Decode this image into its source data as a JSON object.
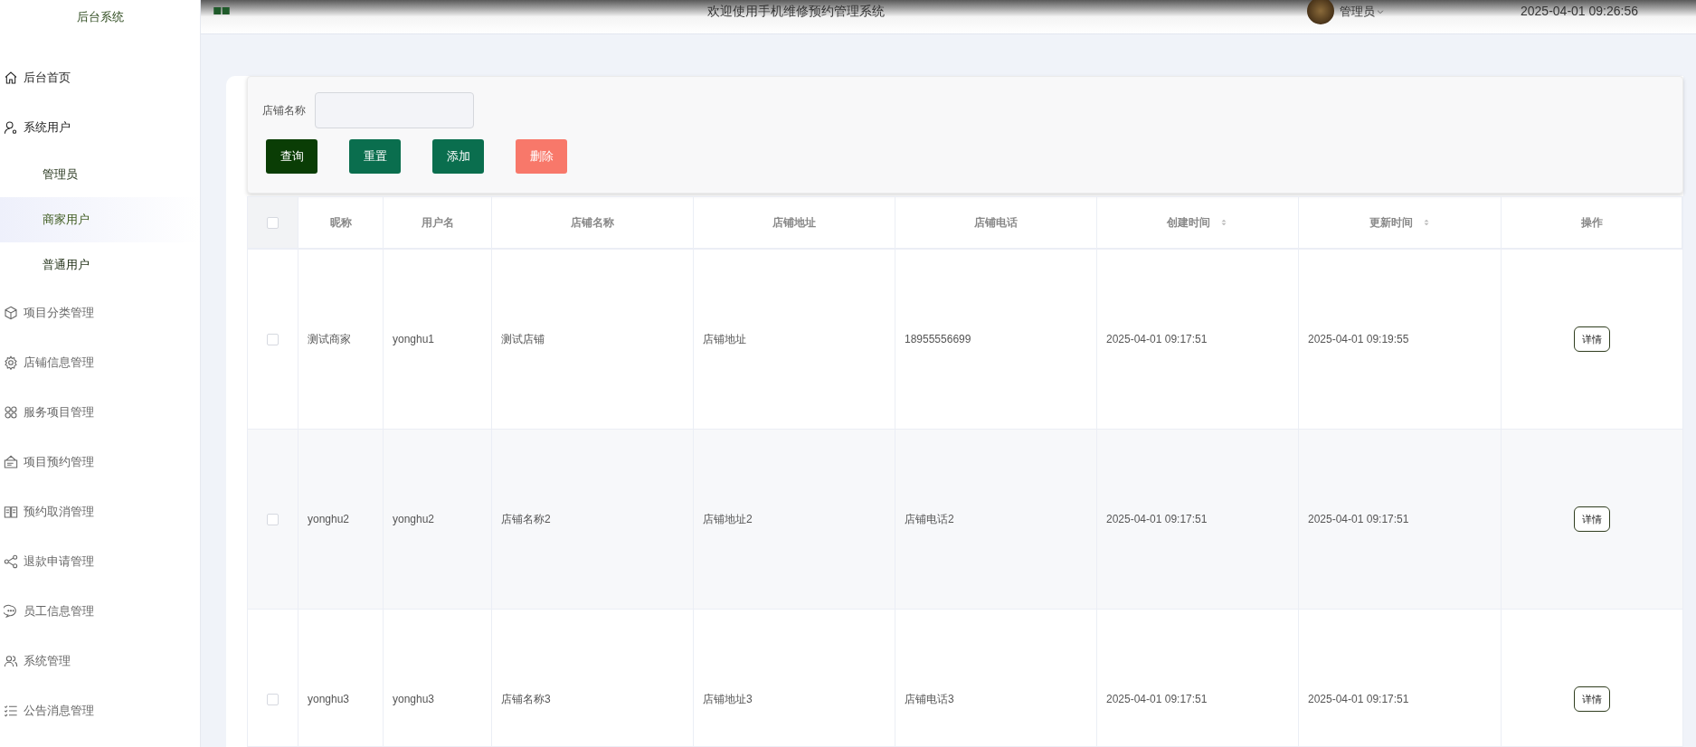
{
  "header": {
    "brand": "后台系统",
    "title": "欢迎使用手机维修预约管理系统",
    "user": "管理员",
    "time": "2025-04-01 09:26:56"
  },
  "sidebar": {
    "items": [
      {
        "label": "后台首页"
      },
      {
        "label": "系统用户",
        "children": [
          {
            "label": "管理员",
            "selected": false
          },
          {
            "label": "商家用户",
            "selected": true
          },
          {
            "label": "普通用户",
            "selected": false
          }
        ]
      },
      {
        "label": "项目分类管理"
      },
      {
        "label": "店铺信息管理"
      },
      {
        "label": "服务项目管理"
      },
      {
        "label": "项目预约管理"
      },
      {
        "label": "预约取消管理"
      },
      {
        "label": "退款申请管理"
      },
      {
        "label": "员工信息管理"
      },
      {
        "label": "系统管理"
      },
      {
        "label": "公告消息管理"
      }
    ]
  },
  "search": {
    "label": "店铺名称"
  },
  "buttons": [
    {
      "label": "查询",
      "kind": "query"
    },
    {
      "label": "重置",
      "kind": "reset"
    },
    {
      "label": "添加",
      "kind": "add"
    },
    {
      "label": "删除",
      "kind": "delete"
    }
  ],
  "table": {
    "columns": [
      {
        "label": "昵称",
        "sortable": false
      },
      {
        "label": "用户名",
        "sortable": false
      },
      {
        "label": "店铺名称",
        "sortable": false
      },
      {
        "label": "店铺地址",
        "sortable": false
      },
      {
        "label": "店铺电话",
        "sortable": false
      },
      {
        "label": "创建时间",
        "sortable": true
      },
      {
        "label": "更新时间",
        "sortable": true
      },
      {
        "label": "操作",
        "sortable": false
      }
    ],
    "header_checked": false,
    "rows": [
      {
        "checked": false,
        "cells": [
          "测试商家",
          "yonghu1",
          "测试店铺",
          "店铺地址",
          "18955556699",
          "2025-04-01 09:17:51",
          "2025-04-01 09:19:55"
        ],
        "action": "详情"
      },
      {
        "checked": false,
        "cells": [
          "yonghu2",
          "yonghu2",
          "店铺名称2",
          "店铺地址2",
          "店铺电话2",
          "2025-04-01 09:17:51",
          "2025-04-01 09:17:51"
        ],
        "action": "详情"
      },
      {
        "checked": false,
        "cells": [
          "yonghu3",
          "yonghu3",
          "店铺名称3",
          "店铺地址3",
          "店铺电话3",
          "2025-04-01 09:17:51",
          "2025-04-01 09:17:51"
        ],
        "action": "详情"
      }
    ]
  }
}
